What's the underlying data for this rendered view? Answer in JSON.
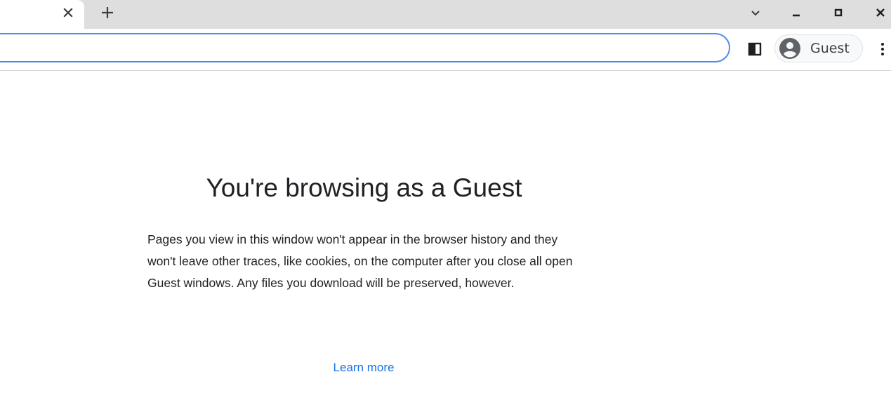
{
  "window": {
    "tab_close_label": "×",
    "new_tab_label": "+",
    "controls": [
      "tab-search",
      "minimize",
      "maximize",
      "close"
    ]
  },
  "toolbar": {
    "address_value": "",
    "profile_label": "Guest"
  },
  "icons": {
    "tab_close": "close-icon",
    "new_tab": "plus-icon",
    "tab_search": "chevron-down-icon",
    "minimize": "minimize-icon",
    "maximize": "maximize-icon",
    "window_close": "close-icon",
    "side_panel": "side-panel-icon",
    "avatar": "account-circle-icon",
    "menu": "kebab-menu-icon"
  },
  "colors": {
    "titlebar": "#dedede",
    "omnibox_border": "#4c8bf5",
    "link": "#1a73e8",
    "text": "#202124"
  },
  "content": {
    "heading": "You're browsing as a Guest",
    "body": "Pages you view in this window won't appear in the browser history and they won't leave other traces, like cookies, on the computer after you close all open Guest windows. Any files you download will be preserved, however.",
    "learn_more": "Learn more"
  }
}
